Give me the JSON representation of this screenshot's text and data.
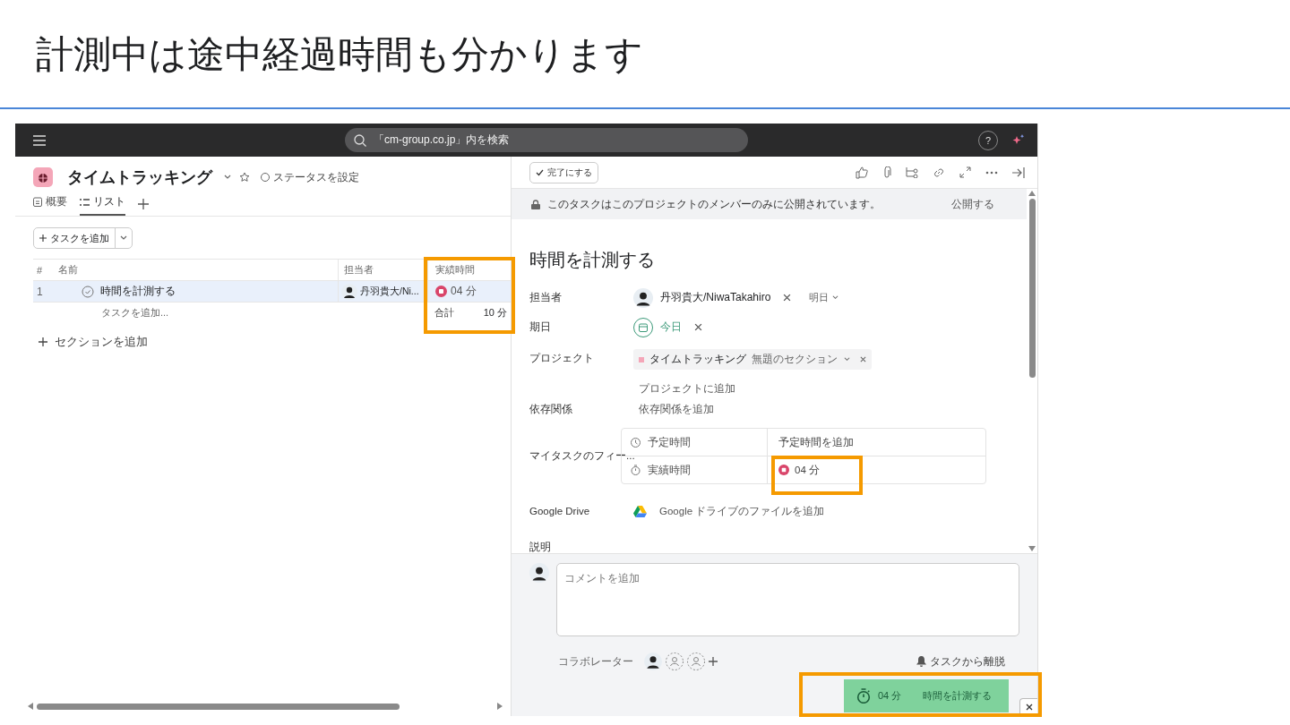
{
  "slide_title": "計測中は途中経過時間も分かります",
  "top_bar": {
    "search_placeholder": "「cm-group.co.jp」内を検索",
    "help": "?"
  },
  "project": {
    "title": "タイムトラッキング",
    "status": "ステータスを設定",
    "tabs": [
      {
        "label": "概要",
        "selected": false
      },
      {
        "label": "リスト",
        "selected": true
      }
    ],
    "add_task": "タスクを追加",
    "table": {
      "columns": [
        "#",
        "名前",
        "担当者",
        "実績時間"
      ],
      "rows": [
        {
          "index": "1",
          "name": "時間を計測する",
          "assignee": "丹羽貴大/Ni...",
          "actual_time": "04 分",
          "timer_running": true,
          "selected": true
        }
      ],
      "add_task_row": "タスクを追加...",
      "total_label": "合計",
      "total": "10 分"
    },
    "add_section": "セクションを追加"
  },
  "task_detail": {
    "complete_button": "完了にする",
    "privacy_notice": "このタスクはこのプロジェクトのメンバーのみに公開されています。",
    "publish": "公開する",
    "title": "時間を計測する",
    "fields": [
      {
        "kind": "assignee",
        "label": "担当者",
        "value": "丹羽貴大/NiwaTakahiro",
        "extra": "明日"
      },
      {
        "kind": "date",
        "label": "期日",
        "value": "今日"
      },
      {
        "kind": "project",
        "label": "プロジェクト",
        "value": "タイムトラッキング",
        "section": "無題のセクション",
        "extra": "プロジェクトに追加"
      },
      {
        "kind": "link",
        "label": "依存関係",
        "value": "依存関係を追加"
      },
      {
        "kind": "custom",
        "label": "マイタスクのフィー...",
        "rows": [
          {
            "kind": "estimate",
            "label": "予定時間",
            "value": "予定時間を追加"
          },
          {
            "kind": "actual",
            "label": "実績時間",
            "value": "04 分",
            "timer_running": true
          }
        ]
      },
      {
        "kind": "drive",
        "label": "Google Drive",
        "value": "Google ドライブのファイルを追加"
      },
      {
        "kind": "description",
        "label": "説明"
      }
    ],
    "comment_placeholder": "コメントを追加",
    "collaborators_label": "コラボレーター",
    "leave": "タスクから離脱",
    "timer": {
      "time": "04 分",
      "label": "時間を計測する"
    }
  }
}
